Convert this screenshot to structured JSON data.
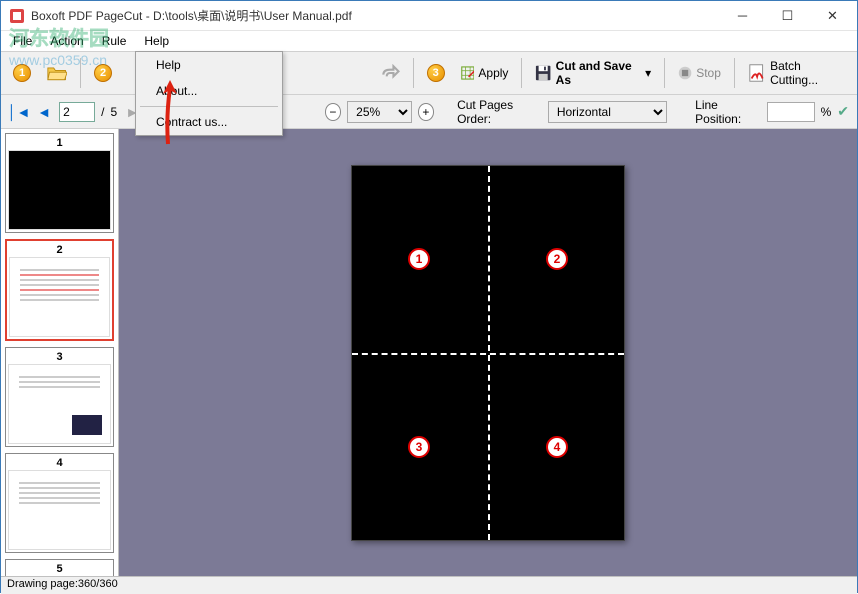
{
  "title": "Boxoft PDF PageCut - D:\\tools\\桌面\\说明书\\User Manual.pdf",
  "menubar": {
    "file": "File",
    "action": "Action",
    "rule": "Rule",
    "help": "Help"
  },
  "toolbar": {
    "badge1": "1",
    "badge2": "2",
    "badge3": "3",
    "apply": "Apply",
    "cutsave": "Cut and Save As",
    "stop": "Stop",
    "batch": "Batch Cutting..."
  },
  "nav": {
    "page_value": "2",
    "of_sep": "/",
    "total": "5",
    "zoom": "25%",
    "order_label": "Cut Pages Order:",
    "order_value": "Horizontal",
    "linepos_label": "Line Position:",
    "linepos_value": "",
    "pct": "%"
  },
  "dropdown": {
    "help": "Help",
    "about": "About...",
    "contract": "Contract us..."
  },
  "thumbs": [
    {
      "label": "1"
    },
    {
      "label": "2"
    },
    {
      "label": "3"
    },
    {
      "label": "4"
    },
    {
      "label": "5"
    }
  ],
  "quads": {
    "q1": "1",
    "q2": "2",
    "q3": "3",
    "q4": "4"
  },
  "status": "Drawing page:360/360",
  "watermark": {
    "line1": "河东软件园",
    "line2": "www.pc0359.cn"
  }
}
